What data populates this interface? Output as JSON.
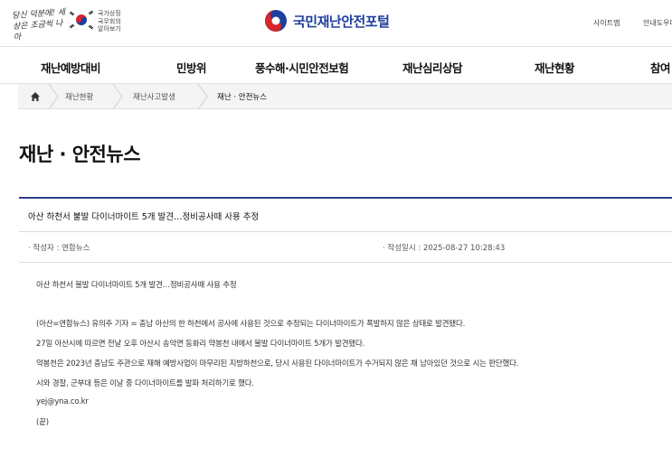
{
  "header": {
    "slogan": "당신 덕분에! 세상은 조금씩 나아",
    "gov_line1": "국가상징",
    "gov_line2": "국무회의",
    "gov_line3": "알아보기",
    "logo_text": "국민재난안전포털",
    "sitemap": "사이트맵",
    "guide": "안내도우미"
  },
  "gnb": [
    "재난예방대비",
    "민방위",
    "풍수해·시민안전보험",
    "재난심리상담",
    "재난현황",
    "참여"
  ],
  "breadcrumb": [
    "재난현황",
    "재난사고발생",
    "재난 · 안전뉴스"
  ],
  "page_title": "재난 · 안전뉴스",
  "article": {
    "title": "아산 하천서 불발 다이너마이트 5개 발견…정비공사때 사용 추정",
    "author": "· 작성자 : 연합뉴스",
    "date": "· 작성일시 : 2025-08-27 10:28:43",
    "body": [
      "아산 하천서 불발 다이너마이트 5개 발견…정비공사때 사용 추정",
      "(아산=연합뉴스) 유의주 기자 = 충남 아산의 한 하천에서 공사에 사용된 것으로 추정되는 다이너마이트가 폭발하지 않은 상태로 발견됐다.",
      "27일 아산시에 따르면 전날 오후 아산시 송악면 동화리 약봉천 내에서 불발 다이너마이트 5개가 발견됐다.",
      "약봉천은 2023년 충남도 주관으로 재해 예방사업이 마무리된 지방하천으로, 당시 사용된 다이너마이트가 수거되지 않은 채 남아있던 것으로 시는 판단했다.",
      "시와 경찰, 군부대 등은 이날 중 다이너마이트를 발파 처리하기로 했다.",
      "yej@yna.co.kr",
      "(끝)"
    ]
  },
  "colors": {
    "brand": "#1e3e9e",
    "accent_red": "#d6262c",
    "article_rule": "#2d3f8c"
  }
}
